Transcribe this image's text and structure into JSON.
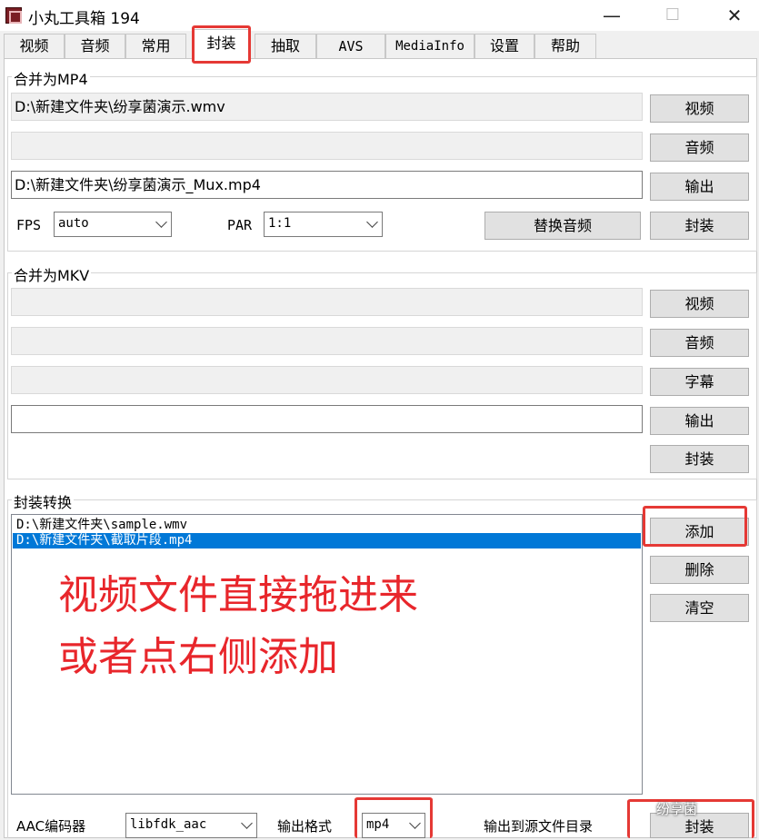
{
  "window": {
    "title": "小丸工具箱 194",
    "controls": {
      "minimize": "—",
      "maximize": "☐",
      "close": "✕"
    }
  },
  "tabs": [
    "视频",
    "音频",
    "常用",
    "封装",
    "抽取",
    "AVS",
    "MediaInfo",
    "设置",
    "帮助"
  ],
  "active_tab": "封装",
  "mp4_group": {
    "title": "合并为MP4",
    "video_path": "D:\\新建文件夹\\纷享菌演示.wmv",
    "audio_path": "",
    "output_path": "D:\\新建文件夹\\纷享菌演示_Mux.mp4",
    "btn_video": "视频",
    "btn_audio": "音频",
    "btn_output": "输出",
    "fps_label": "FPS",
    "fps_value": "auto",
    "par_label": "PAR",
    "par_value": "1:1",
    "btn_replace_audio": "替换音频",
    "btn_mux": "封装"
  },
  "mkv_group": {
    "title": "合并为MKV",
    "video_path": "",
    "audio_path": "",
    "subtitle_path": "",
    "output_path": "",
    "btn_video": "视频",
    "btn_audio": "音频",
    "btn_subtitle": "字幕",
    "btn_output": "输出",
    "btn_mux": "封装"
  },
  "convert_group": {
    "title": "封装转换",
    "files": [
      "D:\\新建文件夹\\sample.wmv",
      "D:\\新建文件夹\\截取片段.mp4"
    ],
    "selected_index": 1,
    "btn_add": "添加",
    "btn_delete": "删除",
    "btn_clear": "清空",
    "aac_label": "AAC编码器",
    "aac_value": "libfdk_aac",
    "format_label": "输出格式",
    "format_value": "mp4",
    "output_src_label": "输出到源文件目录",
    "btn_mux": "封装"
  },
  "annotation": {
    "line1": "视频文件直接拖进来",
    "line2": "或者点右侧添加",
    "color": "#e8262b"
  },
  "watermark": "纷享菌"
}
